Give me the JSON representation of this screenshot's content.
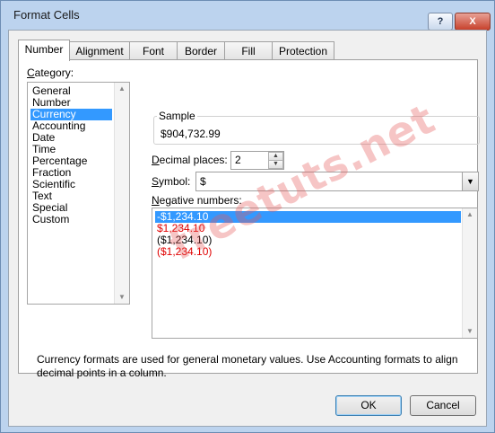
{
  "window": {
    "title": "Format Cells",
    "help_label": "?",
    "close_label": "X"
  },
  "tabs": [
    {
      "label": "Number",
      "active": true
    },
    {
      "label": "Alignment",
      "active": false
    },
    {
      "label": "Font",
      "active": false
    },
    {
      "label": "Border",
      "active": false
    },
    {
      "label": "Fill",
      "active": false
    },
    {
      "label": "Protection",
      "active": false
    }
  ],
  "category": {
    "label": "Category:",
    "items": [
      "General",
      "Number",
      "Currency",
      "Accounting",
      "Date",
      "Time",
      "Percentage",
      "Fraction",
      "Scientific",
      "Text",
      "Special",
      "Custom"
    ],
    "selected": "Currency"
  },
  "sample": {
    "label": "Sample",
    "value": "$904,732.99"
  },
  "decimal": {
    "label": "Decimal places:",
    "value": "2"
  },
  "symbol": {
    "label": "Symbol:",
    "value": "$"
  },
  "negative": {
    "label": "Negative numbers:",
    "items": [
      {
        "text": "-$1,234.10",
        "color": "#000000",
        "selected": true
      },
      {
        "text": "$1,234.10",
        "color": "#e00000",
        "selected": false
      },
      {
        "text": "($1,234.10)",
        "color": "#000000",
        "selected": false
      },
      {
        "text": "($1,234.10)",
        "color": "#e00000",
        "selected": false
      }
    ]
  },
  "watermark": "freetuts.net",
  "description": "Currency formats are used for general monetary values.  Use Accounting formats to align decimal points in a column.",
  "buttons": {
    "ok": "OK",
    "cancel": "Cancel"
  }
}
